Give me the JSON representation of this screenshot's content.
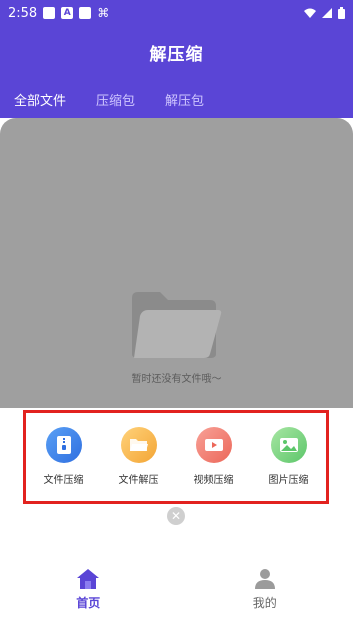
{
  "status_bar": {
    "time": "2:58"
  },
  "header": {
    "title": "解压缩",
    "tabs": [
      {
        "label": "全部文件",
        "active": true
      },
      {
        "label": "压缩包",
        "active": false
      },
      {
        "label": "解压包",
        "active": false
      }
    ]
  },
  "empty_state": {
    "text": "暂时还没有文件哦～"
  },
  "actions": [
    {
      "label": "文件压缩",
      "icon": "zip-file-icon",
      "color": "#3f7be8"
    },
    {
      "label": "文件解压",
      "icon": "folder-open-icon",
      "color": "#f7b84a"
    },
    {
      "label": "视频压缩",
      "icon": "video-play-icon",
      "color": "#f07a6e"
    },
    {
      "label": "图片压缩",
      "icon": "image-icon",
      "color": "#7cd27f"
    }
  ],
  "bottom_nav": [
    {
      "label": "首页",
      "icon": "home-icon",
      "active": true
    },
    {
      "label": "我的",
      "icon": "person-icon",
      "active": false
    }
  ],
  "colors": {
    "brand": "#5a45d6",
    "highlight_border": "#e2221f"
  }
}
